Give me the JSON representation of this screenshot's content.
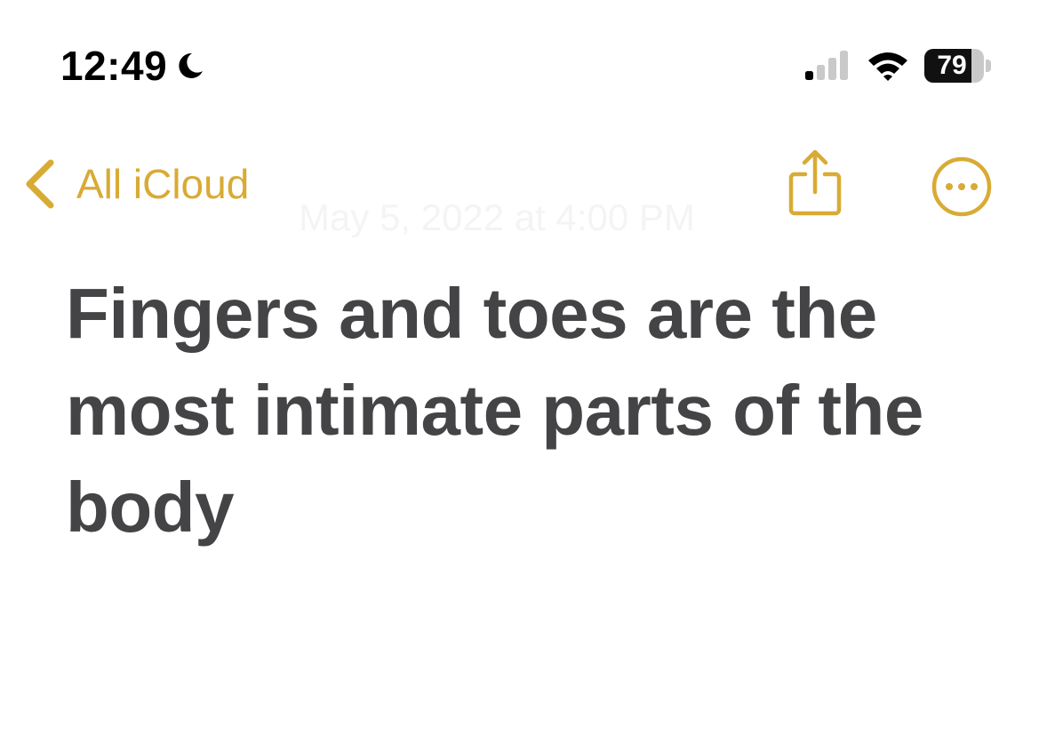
{
  "status_bar": {
    "time": "12:49",
    "focus_icon": "moon-icon",
    "signal_icon": "cellular-signal-icon",
    "signal_bars_active": 1,
    "signal_bars_total": 4,
    "wifi_icon": "wifi-icon",
    "battery_percent": "79",
    "battery_level": 0.79
  },
  "nav": {
    "back_label": "All iCloud",
    "date": "May 5, 2022 at 4:00 PM",
    "share_icon": "share-icon",
    "more_icon": "ellipsis-circle-icon"
  },
  "note": {
    "title": "Fingers and toes are the most intimate parts of the body"
  },
  "colors": {
    "accent": "#d8ab35",
    "title_text": "#444446",
    "status_text": "#000000",
    "date_text_faded": "#f4f4f4",
    "background": "#ffffff"
  }
}
